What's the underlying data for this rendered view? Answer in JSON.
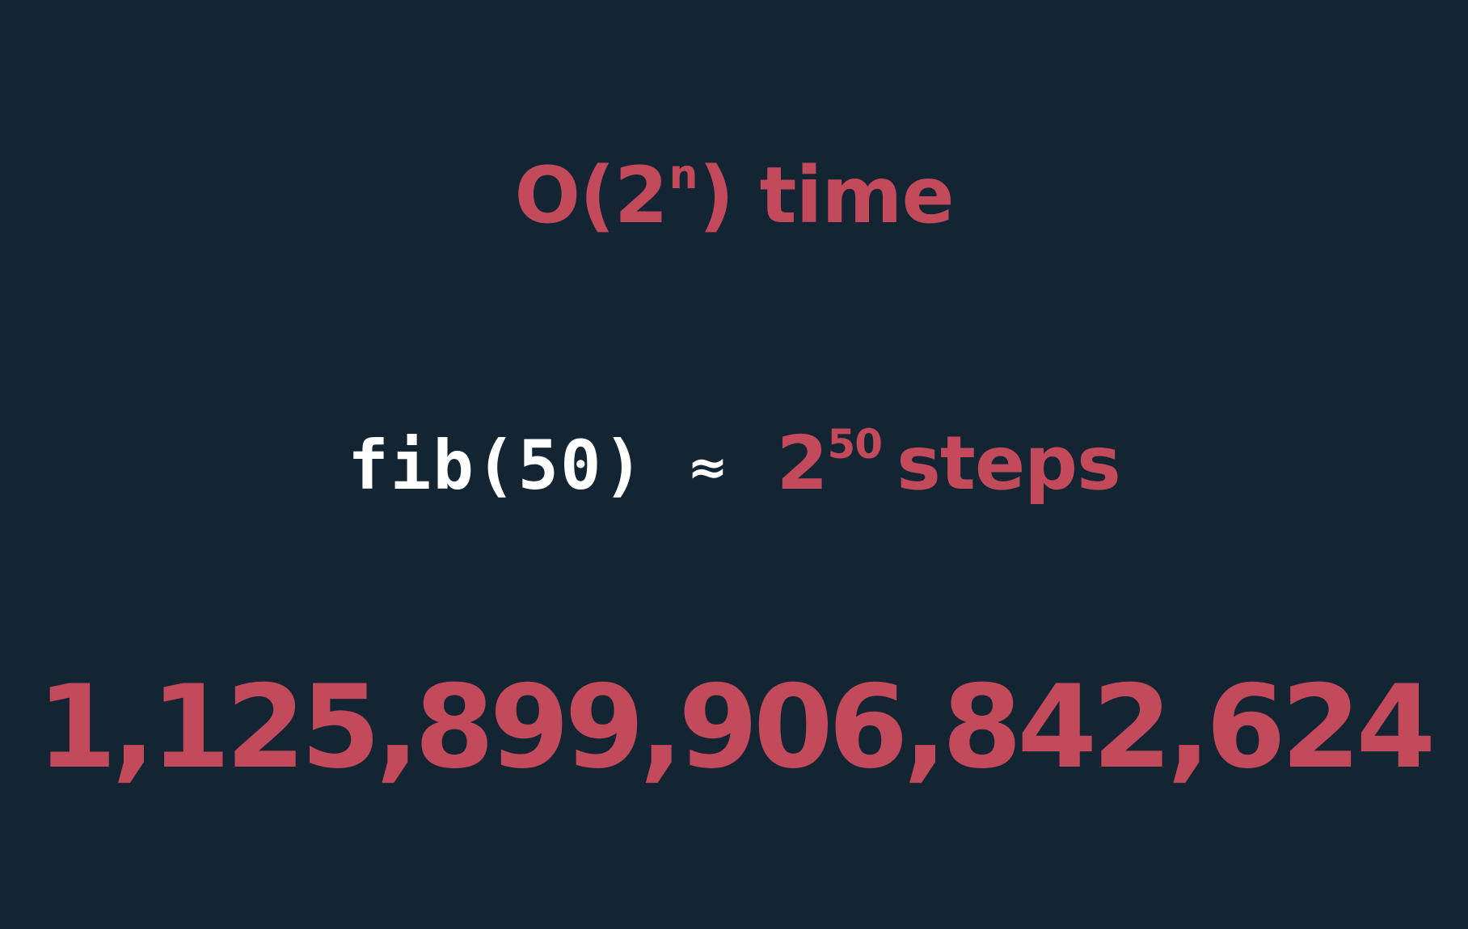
{
  "colors": {
    "background": "#132433",
    "accent": "#c34a5b",
    "code_text": "#ffffff"
  },
  "complexity": {
    "prefix": "O(2",
    "exponent": "n",
    "suffix": ") time"
  },
  "equation": {
    "code": "fib(50)",
    "approx_symbol": "≈",
    "base": "2",
    "exponent": "50",
    "unit": "steps"
  },
  "result": {
    "value": "1,125,899,906,842,624"
  }
}
